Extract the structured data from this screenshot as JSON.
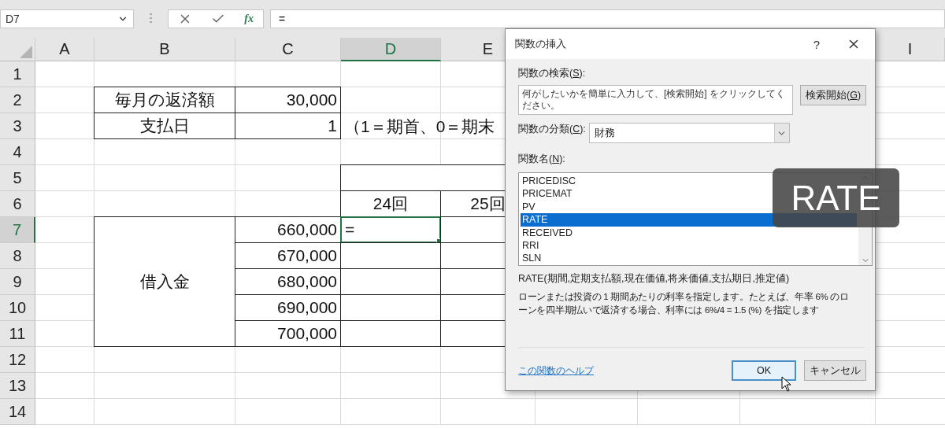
{
  "name_box": "D7",
  "formula_bar": {
    "fx": "fx",
    "value": "="
  },
  "columns": [
    {
      "label": "A",
      "selected": false
    },
    {
      "label": "B",
      "selected": false
    },
    {
      "label": "C",
      "selected": false
    },
    {
      "label": "D",
      "selected": true
    },
    {
      "label": "E",
      "selected": false
    },
    {
      "label": "I",
      "selected": false
    }
  ],
  "rows": [
    {
      "number": "1",
      "selected": false
    },
    {
      "number": "2",
      "selected": false,
      "cells": {
        "b": {
          "kind": "label",
          "text": "毎月の返済額",
          "active": false
        },
        "c": {
          "kind": "number",
          "text": "30,000",
          "active": false
        }
      }
    },
    {
      "number": "3",
      "selected": false,
      "cells": {
        "b": {
          "kind": "label",
          "text": "支払日",
          "active": false
        },
        "c": {
          "kind": "number",
          "text": "1",
          "active": false
        },
        "d": {
          "kind": "note",
          "text": "（1＝期首、0＝期末",
          "active": false
        }
      }
    },
    {
      "number": "4",
      "selected": false
    },
    {
      "number": "5",
      "selected": false,
      "cells": {
        "d": {
          "kind": "band"
        }
      }
    },
    {
      "number": "6",
      "selected": false,
      "cells": {
        "d": {
          "kind": "label",
          "text": "24回",
          "active": false
        },
        "e": {
          "kind": "label",
          "text": "25回",
          "active": false
        }
      }
    },
    {
      "number": "7",
      "selected": true,
      "cells": {
        "b": {
          "kind": "group_label",
          "text": "借入金",
          "active": false
        },
        "c": {
          "kind": "number",
          "text": "660,000",
          "active": false
        },
        "d": {
          "kind": "entry",
          "text": "=",
          "active": true
        },
        "e": {
          "kind": "box"
        }
      }
    },
    {
      "number": "8",
      "selected": false,
      "cells": {
        "c": {
          "kind": "number",
          "text": "670,000",
          "active": false
        },
        "d": {
          "kind": "box"
        },
        "e": {
          "kind": "box"
        }
      }
    },
    {
      "number": "9",
      "selected": false,
      "cells": {
        "c": {
          "kind": "number",
          "text": "680,000",
          "active": false
        },
        "d": {
          "kind": "box"
        },
        "e": {
          "kind": "box"
        }
      }
    },
    {
      "number": "10",
      "selected": false,
      "cells": {
        "c": {
          "kind": "number",
          "text": "690,000",
          "active": false
        },
        "d": {
          "kind": "box"
        },
        "e": {
          "kind": "box"
        }
      }
    },
    {
      "number": "11",
      "selected": false,
      "cells": {
        "c": {
          "kind": "number",
          "text": "700,000",
          "active": false
        },
        "d": {
          "kind": "box"
        },
        "e": {
          "kind": "box"
        }
      }
    },
    {
      "number": "12",
      "selected": false
    },
    {
      "number": "13",
      "selected": false
    },
    {
      "number": "14",
      "selected": false
    }
  ],
  "dialog": {
    "title": "関数の挿入",
    "help": "?",
    "search": {
      "label": {
        "before": "関数の検索(",
        "key": "S",
        "after": "):"
      },
      "value": "何がしたいかを簡単に入力して、[検索開始] をクリックしてください。",
      "button": {
        "before": "検索開始(",
        "key": "G",
        "after": ")"
      }
    },
    "category": {
      "label": {
        "before": "関数の分類(",
        "key": "C",
        "after": "):"
      },
      "value": "財務"
    },
    "list": {
      "label": {
        "before": "関数名(",
        "key": "N",
        "after": "):"
      },
      "items": [
        {
          "name": "PRICEDISC",
          "selected": false
        },
        {
          "name": "PRICEMAT",
          "selected": false
        },
        {
          "name": "PV",
          "selected": false
        },
        {
          "name": "RATE",
          "selected": true
        },
        {
          "name": "RECEIVED",
          "selected": false
        },
        {
          "name": "RRI",
          "selected": false
        },
        {
          "name": "SLN",
          "selected": false
        }
      ]
    },
    "syntax": "RATE(期間,定期支払額,現在価値,将来価値,支払期日,推定値)",
    "description": "ローンまたは投資の 1 期間あたりの利率を指定します。たとえば、年率 6% のローンを四半期払いで返済する場合、利率には 6%/4 = 1.5 (%) を指定します",
    "help_link": "この関数のヘルプ",
    "buttons": [
      {
        "label": "OK",
        "default": true
      },
      {
        "label": "キャンセル",
        "default": false
      }
    ]
  },
  "caption": "RATE"
}
